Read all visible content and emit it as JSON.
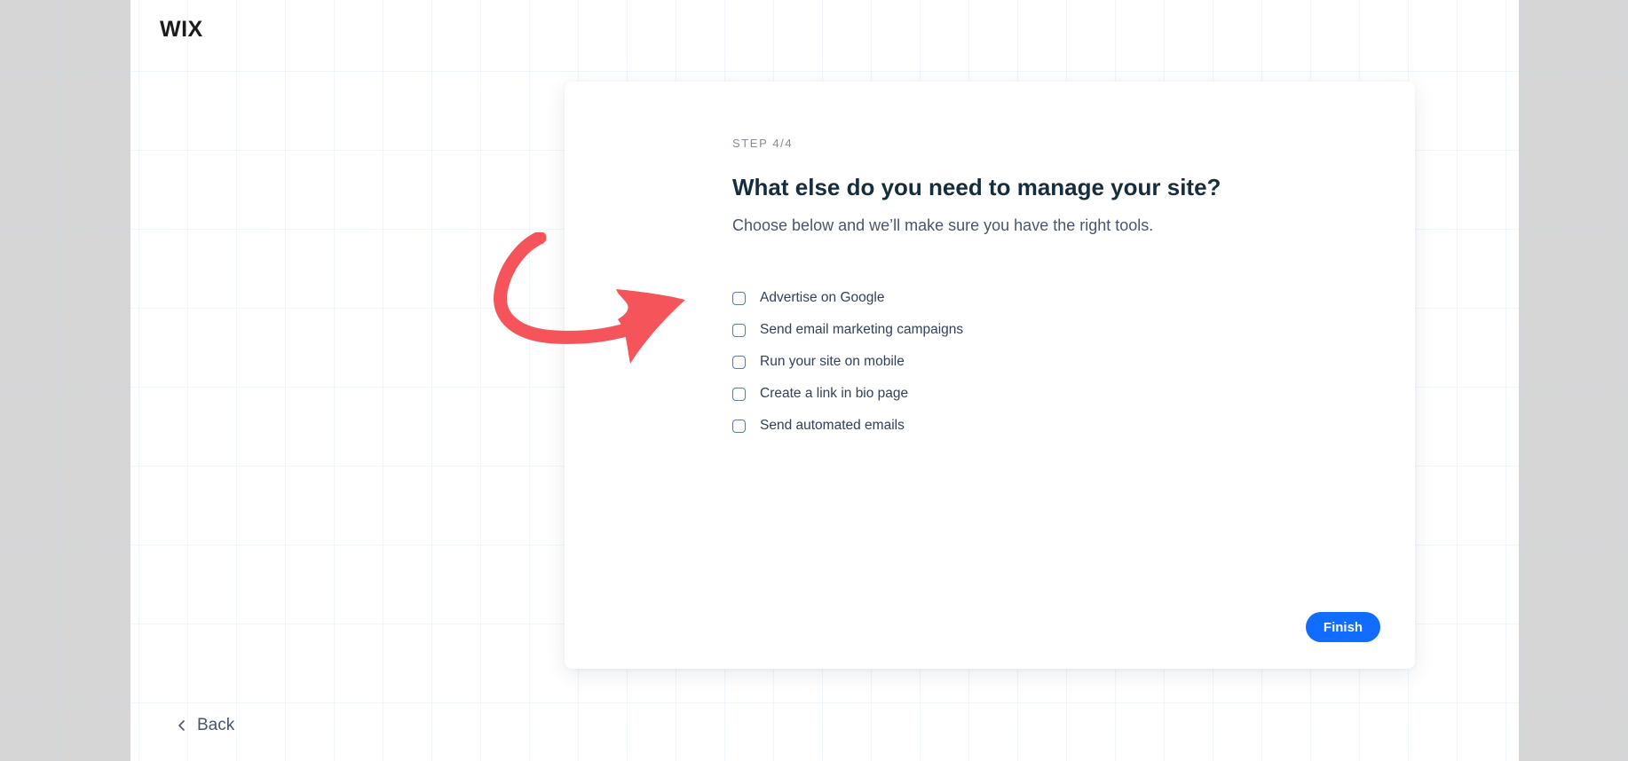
{
  "brand": {
    "logo_text": "WIX"
  },
  "wizard": {
    "step_label": "STEP 4/4",
    "title": "What else do you need to manage your site?",
    "subtitle": "Choose below and we’ll make sure you have the right tools.",
    "options": [
      {
        "label": "Advertise on Google",
        "checked": false
      },
      {
        "label": "Send email marketing campaigns",
        "checked": false
      },
      {
        "label": "Run your site on mobile",
        "checked": false
      },
      {
        "label": "Create a link in bio page",
        "checked": false
      },
      {
        "label": "Send automated emails",
        "checked": false
      }
    ],
    "finish_label": "Finish"
  },
  "nav": {
    "back_label": "Back",
    "back_icon": "chevron-left-icon"
  },
  "annotation": {
    "icon": "curved-arrow-icon",
    "color": "#f5555a"
  },
  "colors": {
    "primary": "#116dff",
    "checkbox_border": "#3b7ee8",
    "title": "#162d3d",
    "page_background": "#ffffff",
    "outer_background": "#d6d6d6"
  }
}
